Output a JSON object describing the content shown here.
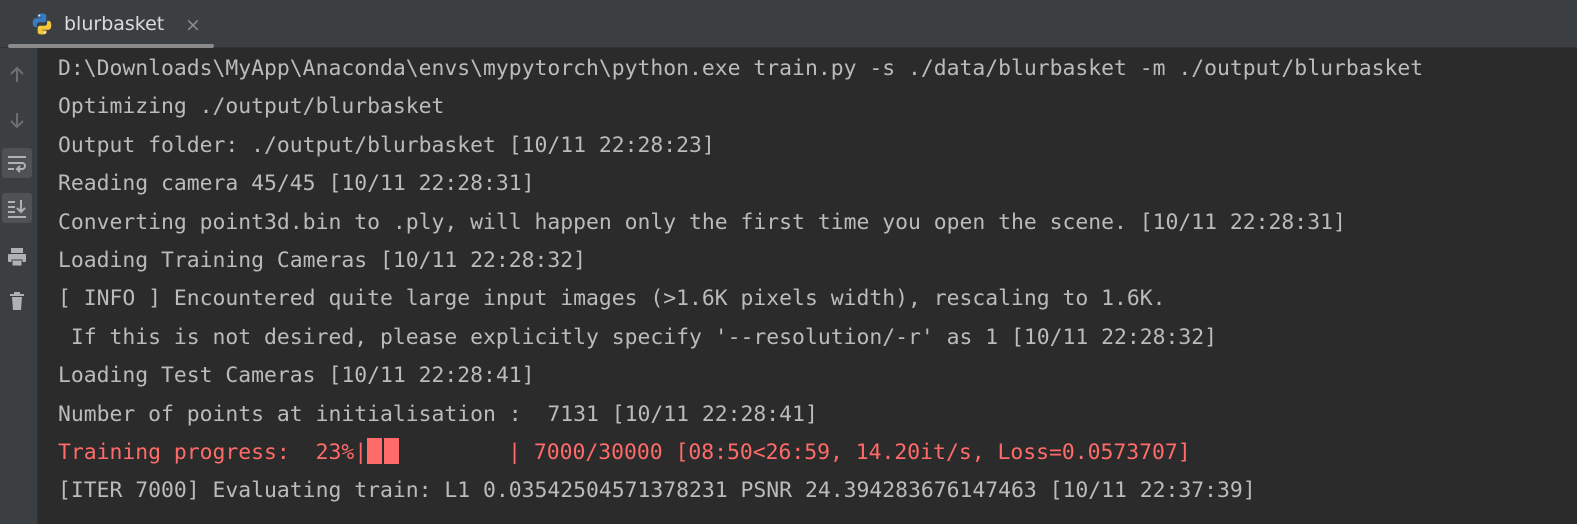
{
  "tab": {
    "title": "blurbasket",
    "close_glyph": "×",
    "icon": "python-icon"
  },
  "sidebar": {
    "buttons": [
      {
        "name": "up-arrow-icon",
        "active": false
      },
      {
        "name": "down-arrow-icon",
        "active": false
      },
      {
        "name": "soft-wrap-icon",
        "active": true
      },
      {
        "name": "scroll-to-end-icon",
        "active": true
      },
      {
        "name": "print-icon",
        "active": false
      },
      {
        "name": "trash-icon",
        "active": false
      }
    ]
  },
  "colors": {
    "background": "#2b2b2b",
    "text": "#bbbbbb",
    "error_text": "#ff6b68",
    "panel": "#3c3f41"
  },
  "console": {
    "lines": [
      "D:\\Downloads\\MyApp\\Anaconda\\envs\\mypytorch\\python.exe train.py -s ./data/blurbasket -m ./output/blurbasket",
      "Optimizing ./output/blurbasket",
      "Output folder: ./output/blurbasket [10/11 22:28:23]",
      "Reading camera 45/45 [10/11 22:28:31]",
      "Converting point3d.bin to .ply, will happen only the first time you open the scene. [10/11 22:28:31]",
      "Loading Training Cameras [10/11 22:28:32]",
      "[ INFO ] Encountered quite large input images (>1.6K pixels width), rescaling to 1.6K.",
      " If this is not desired, please explicitly specify '--resolution/-r' as 1 [10/11 22:28:32]",
      "Loading Test Cameras [10/11 22:28:41]",
      "Number of points at initialisation :  7131 [10/11 22:28:41]"
    ],
    "progress": {
      "prefix": "Training progress:  23%|",
      "fraction": 0.23,
      "suffix": "| 7000/30000 [08:50<26:59, 14.20it/s, Loss=0.0573707]"
    },
    "last_line": "[ITER 7000] Evaluating train: L1 0.03542504571378231 PSNR 24.394283676147463 [10/11 22:37:39]"
  }
}
